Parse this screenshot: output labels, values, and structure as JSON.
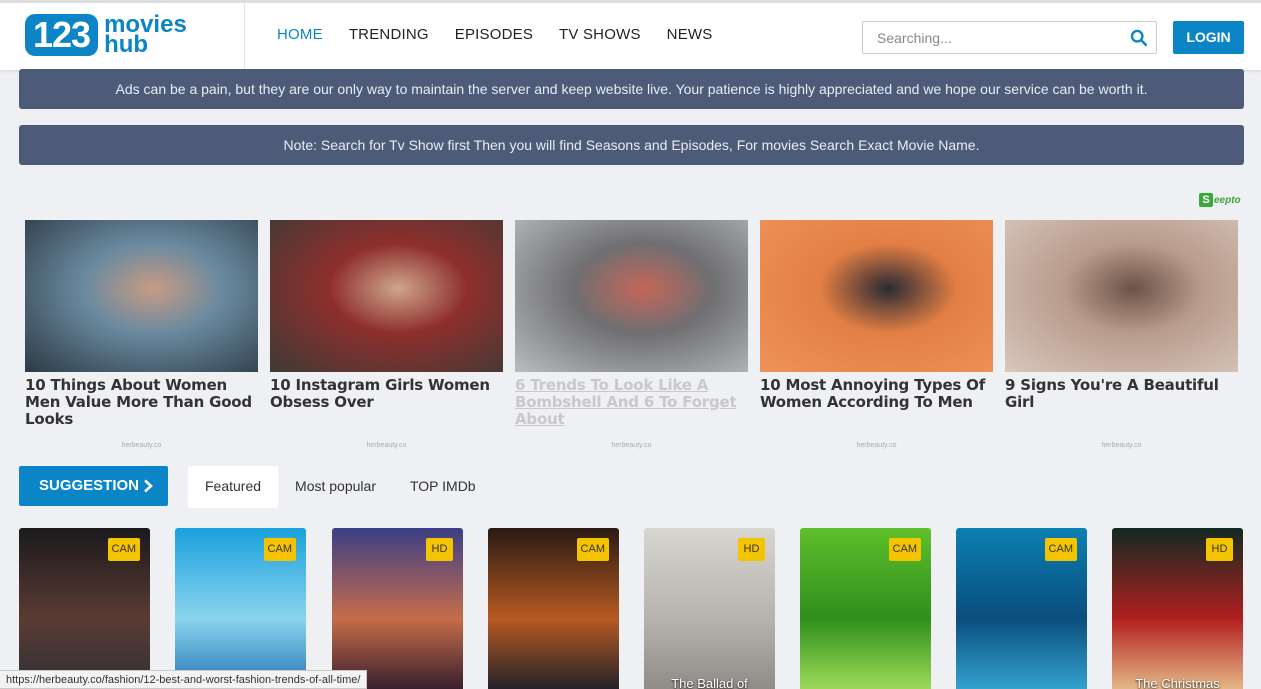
{
  "header": {
    "logo_number": "123",
    "logo_line1": "movies",
    "logo_line2": "hub",
    "nav": [
      "HOME",
      "TRENDING",
      "EPISODES",
      "TV SHOWS",
      "NEWS"
    ],
    "search_placeholder": "Searching...",
    "login_label": "LOGIN"
  },
  "notices": {
    "ads_notice": "Ads can be a pain, but they are our only way to maintain the server and keep website live. Your patience is highly appreciated and we hope our service can be worth it.",
    "search_notice": "Note: Search for Tv Show first Then you will find Seasons and Episodes, For movies Search Exact Movie Name."
  },
  "ad_widget": {
    "brand_letter": "S",
    "brand_text": "eepto",
    "items": [
      {
        "title": "10 Things About Women Men Value More Than Good Looks",
        "source": "herbeauty.co",
        "colors": [
          "#2c3944",
          "#6a8aa0",
          "#c89b83"
        ]
      },
      {
        "title": "10 Instagram Girls Women Obsess Over",
        "source": "herbeauty.co",
        "colors": [
          "#3d3a36",
          "#8e2f2c",
          "#cfa58c"
        ]
      },
      {
        "title": "6 Trends To Look Like A Bombshell And 6 To Forget About",
        "source": "herbeauty.co",
        "colors": [
          "#b9bcc0",
          "#6f6f72",
          "#c46659"
        ]
      },
      {
        "title": "10 Most Annoying Types Of Women According To Men",
        "source": "herbeauty.co",
        "colors": [
          "#ee9358",
          "#e37f44",
          "#2a2a33"
        ]
      },
      {
        "title": "9 Signs You're A Beautiful Girl",
        "source": "herbeauty.co",
        "colors": [
          "#d8c7bd",
          "#b89b8b",
          "#6c5248"
        ]
      }
    ]
  },
  "suggestion": {
    "button_label": "SUGGESTION",
    "tabs": [
      "Featured",
      "Most popular",
      "TOP IMDb"
    ]
  },
  "movies": [
    {
      "badge": "CAM",
      "title": "",
      "colors": [
        "#1a1a1c",
        "#5b3b33",
        "#2b2f36"
      ]
    },
    {
      "badge": "CAM",
      "title": "",
      "colors": [
        "#1aa0dc",
        "#8ad4ef",
        "#1f6fb0"
      ]
    },
    {
      "badge": "HD",
      "title": "",
      "colors": [
        "#3b3f86",
        "#c66c4a",
        "#301b2b"
      ]
    },
    {
      "badge": "CAM",
      "title": "",
      "colors": [
        "#2a1a14",
        "#b65a22",
        "#1b1f28"
      ]
    },
    {
      "badge": "HD",
      "title": "The Ballad of",
      "colors": [
        "#d8d6d0",
        "#b6b3ad",
        "#8d8a85"
      ]
    },
    {
      "badge": "CAM",
      "title": "",
      "colors": [
        "#5fbf2b",
        "#2f8f1d",
        "#a4de5b"
      ]
    },
    {
      "badge": "CAM",
      "title": "",
      "colors": [
        "#0c7fb2",
        "#0a4e7d",
        "#36a6d3"
      ]
    },
    {
      "badge": "HD",
      "title": "The Christmas",
      "colors": [
        "#122a22",
        "#b01f1f",
        "#e7c08c"
      ]
    }
  ],
  "status_url": "https://herbeauty.co/fashion/12-best-and-worst-fashion-trends-of-all-time/",
  "accent": "#0b85c6",
  "notice_bg": "#4d5a78",
  "badge_color": "#f5c400"
}
